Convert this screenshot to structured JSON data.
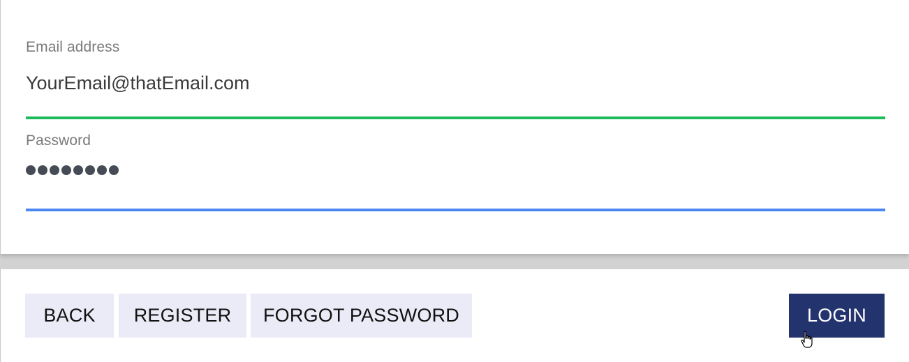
{
  "form": {
    "email": {
      "label": "Email address",
      "value": "YourEmail@thatEmail.com"
    },
    "password": {
      "label": "Password",
      "masked_length": 8
    }
  },
  "actions": {
    "back_label": "BACK",
    "register_label": "REGISTER",
    "forgot_password_label": "FORGOT PASSWORD",
    "login_label": "LOGIN"
  },
  "colors": {
    "email_underline": "#1fba5b",
    "password_underline": "#4c86f0",
    "primary_button": "#22336e",
    "secondary_button": "#ebebf7"
  }
}
